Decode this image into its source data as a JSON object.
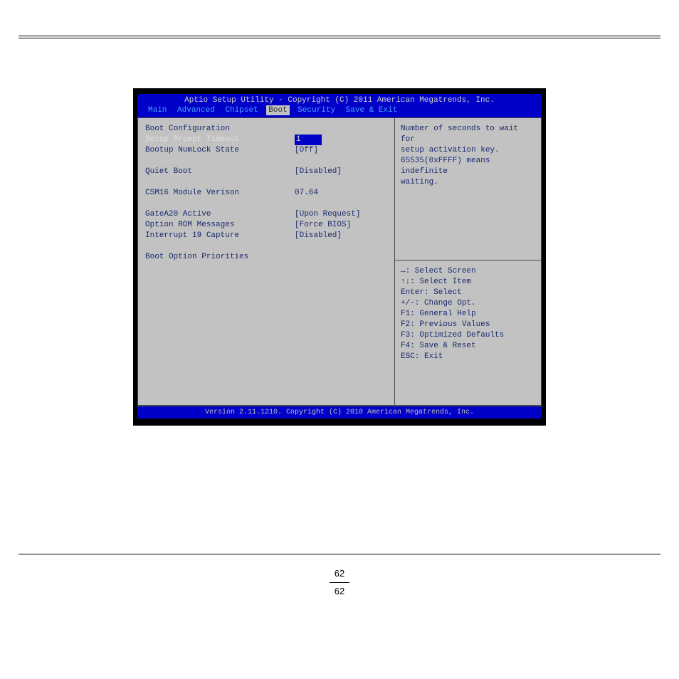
{
  "title": "Aptio Setup Utility - Copyright (C) 2011 American Megatrends, Inc.",
  "menu": {
    "items": [
      "Main",
      "Advanced",
      "Chipset",
      "Boot",
      "Security",
      "Save & Exit"
    ],
    "active_index": 3
  },
  "left": {
    "header": "Boot Configuration",
    "rows": [
      {
        "label": "Setup Prompt Timeout",
        "value": "1",
        "selected": true
      },
      {
        "label": "Bootup NumLock State",
        "value": "[Off]"
      }
    ],
    "rows2": [
      {
        "label": "Quiet Boot",
        "value": "[Disabled]"
      }
    ],
    "rows3": [
      {
        "label": "CSM16 Module Verison",
        "value": "07.64"
      }
    ],
    "rows4": [
      {
        "label": "GateA20 Active",
        "value": "[Upon Request]"
      },
      {
        "label": "Option ROM Messages",
        "value": "[Force BIOS]"
      },
      {
        "label": "Interrupt 19 Capture",
        "value": "[Disabled]"
      }
    ],
    "section2": "Boot Option Priorities"
  },
  "help": {
    "l1": "Number of seconds to wait for",
    "l2": "setup activation key.",
    "l3": "65535(0xFFFF) means indefinite",
    "l4": "waiting."
  },
  "keys": {
    "k1": "↔: Select Screen",
    "k2": "↑↓: Select Item",
    "k3": "Enter: Select",
    "k4": "+/-: Change Opt.",
    "k5": "F1: General Help",
    "k6": "F2: Previous Values",
    "k7": "F3: Optimized Defaults",
    "k8": "F4: Save & Reset",
    "k9": "ESC: Exit"
  },
  "footer": "Version 2.11.1210. Copyright (C) 2010 American Megatrends, Inc.",
  "page": {
    "top": "62",
    "bottom": "62"
  }
}
